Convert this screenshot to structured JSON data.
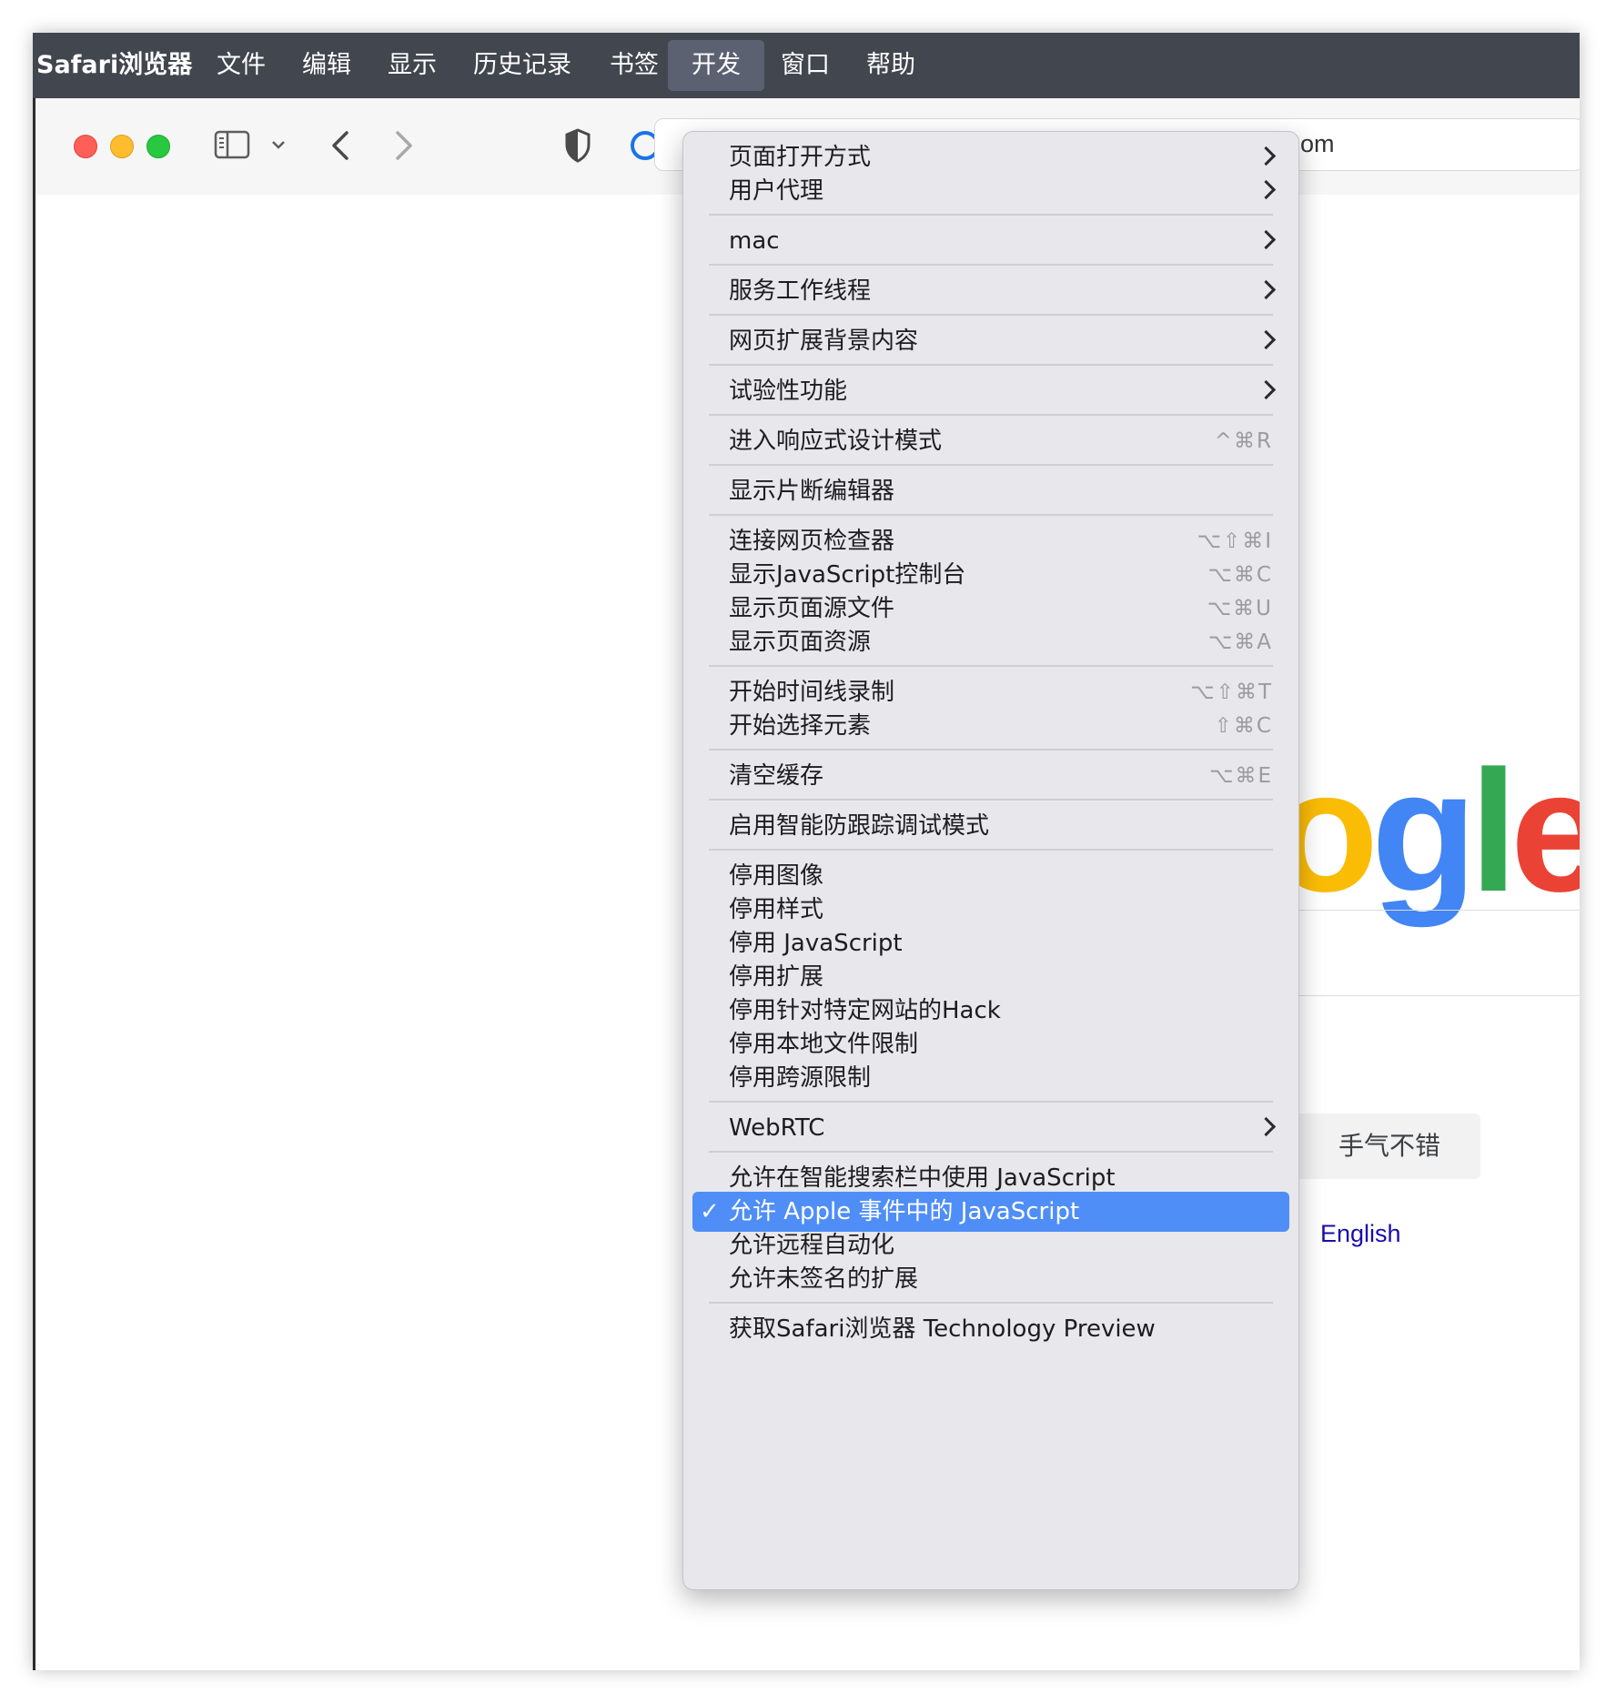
{
  "menubar": {
    "app": "Safari浏览器",
    "items": [
      "文件",
      "编辑",
      "显示",
      "历史记录",
      "书签",
      "开发",
      "窗口",
      "帮助"
    ],
    "active": "开发"
  },
  "toolbar": {
    "address_text": "e.com"
  },
  "page": {
    "logo_text": "ogle",
    "lucky_button": "手气不错",
    "english_link": "English"
  },
  "develop_menu": {
    "items": [
      {
        "label": "页面打开方式",
        "submenu": true
      },
      {
        "label": "用户代理",
        "submenu": true
      },
      {
        "label": "mac",
        "submenu": true
      },
      {
        "label": "服务工作线程",
        "submenu": true
      },
      {
        "label": "网页扩展背景内容",
        "submenu": true
      },
      {
        "label": "试验性功能",
        "submenu": true
      },
      {
        "label": "进入响应式设计模式",
        "shortcut": "^⌘R"
      },
      {
        "label": "显示片断编辑器"
      },
      {
        "label": "连接网页检查器",
        "shortcut": "⌥⇧⌘I"
      },
      {
        "label": "显示JavaScript控制台",
        "shortcut": "⌥⌘C"
      },
      {
        "label": "显示页面源文件",
        "shortcut": "⌥⌘U"
      },
      {
        "label": "显示页面资源",
        "shortcut": "⌥⌘A"
      },
      {
        "label": "开始时间线录制",
        "shortcut": "⌥⇧⌘T"
      },
      {
        "label": "开始选择元素",
        "shortcut": "⇧⌘C"
      },
      {
        "label": "清空缓存",
        "shortcut": "⌥⌘E"
      },
      {
        "label": "启用智能防跟踪调试模式"
      },
      {
        "label": "停用图像"
      },
      {
        "label": "停用样式"
      },
      {
        "label": "停用 JavaScript"
      },
      {
        "label": "停用扩展"
      },
      {
        "label": "停用针对特定网站的Hack"
      },
      {
        "label": "停用本地文件限制"
      },
      {
        "label": "停用跨源限制"
      },
      {
        "label": "WebRTC",
        "submenu": true
      },
      {
        "label": "允许在智能搜索栏中使用 JavaScript"
      },
      {
        "label": "允许 Apple 事件中的 JavaScript",
        "checked": true,
        "highlighted": true
      },
      {
        "label": "允许远程自动化"
      },
      {
        "label": "允许未签名的扩展"
      },
      {
        "label": "获取Safari浏览器 Technology Preview"
      }
    ],
    "check_mark": "✓"
  },
  "colors": {
    "menubar_bg": "#42464f",
    "menu_bg": "#e8e7eb",
    "highlight": "#4f8ef7",
    "google_blue": "#4285f4",
    "google_red": "#ea4335",
    "google_yellow": "#fbbc05",
    "google_green": "#34a853"
  }
}
